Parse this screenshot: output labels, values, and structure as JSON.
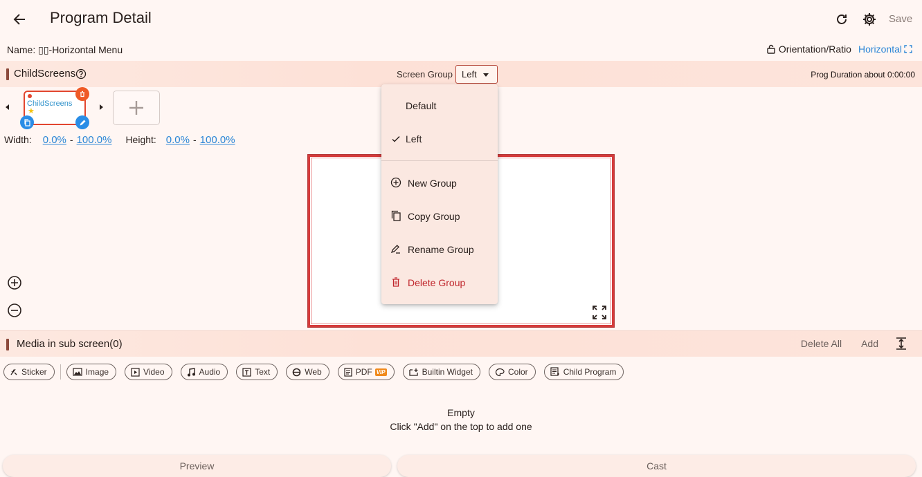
{
  "appbar": {
    "title": "Program Detail",
    "save_label": "Save"
  },
  "program": {
    "name_label": "Name: ",
    "name_value": "▯▯-Horizontal Menu",
    "orientation_label": "Orientation/Ratio",
    "orientation_value": "Horizontal"
  },
  "child_section": {
    "title": "ChildScreens",
    "screen_group_label": "Screen Group",
    "screen_group_value": "Left",
    "prog_duration": "Prog Duration about 0:00:00",
    "thumb_label": "ChildScreens",
    "width_label": "Width:",
    "width_from": "0.0%",
    "width_to": "100.0%",
    "height_label": "Height:",
    "height_from": "0.0%",
    "height_to": "100.0%",
    "dash": "-"
  },
  "group_menu": {
    "items": [
      {
        "label": "Default",
        "checked": false
      },
      {
        "label": "Left",
        "checked": true
      }
    ],
    "actions": [
      {
        "label": "New Group",
        "icon": "add-circle-icon"
      },
      {
        "label": "Copy Group",
        "icon": "copy-icon"
      },
      {
        "label": "Rename Group",
        "icon": "rename-icon"
      },
      {
        "label": "Delete Group",
        "icon": "trash-icon",
        "color": "#c0262c"
      }
    ]
  },
  "media_section": {
    "title": "Media in sub screen(0)",
    "delete_all_label": "Delete All",
    "add_label": "Add",
    "chips": [
      {
        "label": "Sticker",
        "icon": "sticker-icon"
      },
      {
        "label": "Image",
        "icon": "image-icon"
      },
      {
        "label": "Video",
        "icon": "video-icon"
      },
      {
        "label": "Audio",
        "icon": "music-note-icon"
      },
      {
        "label": "Text",
        "icon": "text-icon"
      },
      {
        "label": "Web",
        "icon": "web-icon"
      },
      {
        "label": "PDF",
        "icon": "pdf-icon",
        "badge": "VIP"
      },
      {
        "label": "Builtin Widget",
        "icon": "widget-icon"
      },
      {
        "label": "Color",
        "icon": "palette-icon"
      },
      {
        "label": "Child Program",
        "icon": "child-program-icon"
      }
    ],
    "empty_title": "Empty",
    "empty_hint": "Click \"Add\" on the top to add one"
  },
  "bottom": {
    "preview_label": "Preview",
    "cast_label": "Cast"
  },
  "colors": {
    "accent": "#2b86d6",
    "danger": "#c0262c",
    "frame": "#d43a3a",
    "section_bar": "#fde1d7"
  }
}
